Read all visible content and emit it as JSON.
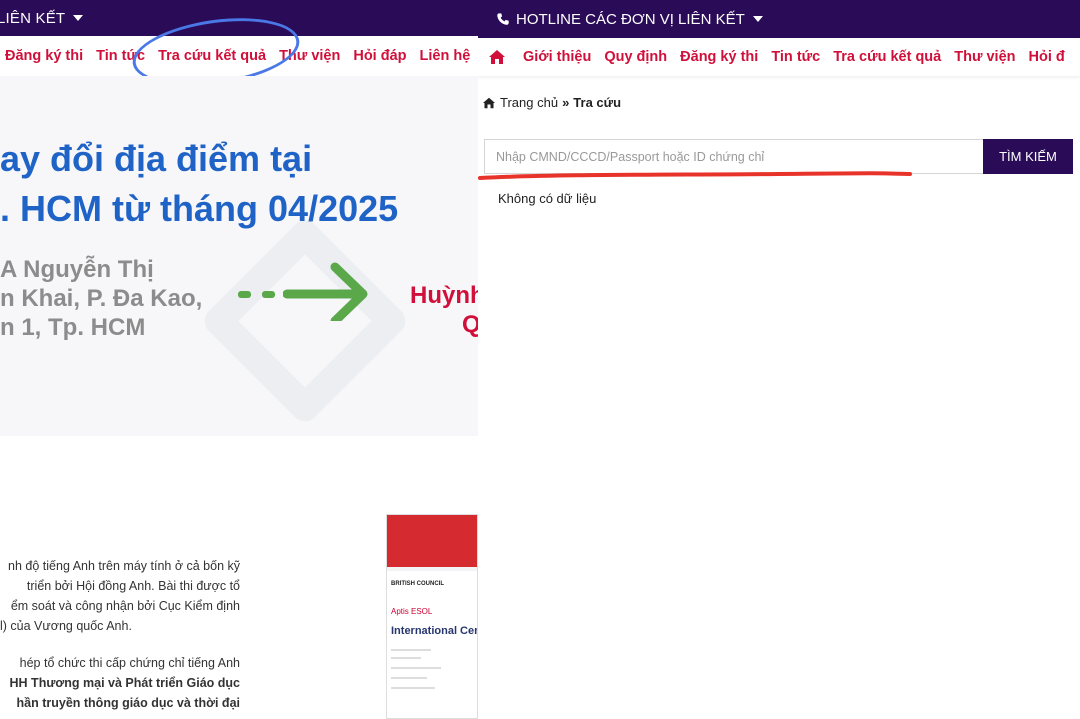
{
  "left_pane": {
    "topbar": {
      "label": "LIÊN KẾT"
    },
    "nav": [
      "Đăng ký thi",
      "Tin tức",
      "Tra cứu kết quả",
      "Thư viện",
      "Hỏi đáp",
      "Liên hệ"
    ],
    "hero": {
      "title_line1": "ay đổi địa điểm tại",
      "title_line2": ". HCM từ tháng 04/2025",
      "addr_line1": "A Nguyễn Thị",
      "addr_line2": "n Khai, P. Đa Kao,",
      "addr_line3": "n 1, Tp. HCM",
      "new_line1": "Huỳnh",
      "new_line2": "Q"
    },
    "article": {
      "p1": [
        "nh độ tiếng Anh trên máy tính ở cả bốn kỹ",
        "triển bởi Hội đồng Anh. Bài thi được tổ",
        "ểm soát và công nhận bởi Cục Kiểm định",
        "l) của Vương quốc Anh."
      ],
      "p2_l1": "hép tổ chức thi cấp chứng chỉ tiếng Anh",
      "p2_l2": "HH Thương mại và Phát triển Giáo dục",
      "p2_l3": "hần truyền thông giáo dục và thời đại"
    },
    "certificate": {
      "logo": "BRITISH COUNCIL",
      "product": "Aptis ESOL",
      "heading": "International Cer"
    }
  },
  "right_pane": {
    "topbar": {
      "label": "HOTLINE CÁC ĐƠN VỊ LIÊN KẾT"
    },
    "nav": [
      "Giới thiệu",
      "Quy định",
      "Đăng ký thi",
      "Tin tức",
      "Tra cứu kết quả",
      "Thư viện",
      "Hỏi đ"
    ],
    "breadcrumb": {
      "home": "Trang chủ",
      "current": "Tra cứu"
    },
    "search": {
      "placeholder": "Nhập CMND/CCCD/Passport hoặc ID chứng chỉ",
      "value": "",
      "button": "TÌM KIẾM"
    },
    "result": "Không có dữ liệu"
  },
  "colors": {
    "header_purple": "#2a0b57",
    "nav_red": "#d0103a",
    "hero_blue": "#1f63c6",
    "annotation_blue": "#4a78e6",
    "annotation_red": "#e8332b",
    "arrow_green": "#5aa84a"
  }
}
